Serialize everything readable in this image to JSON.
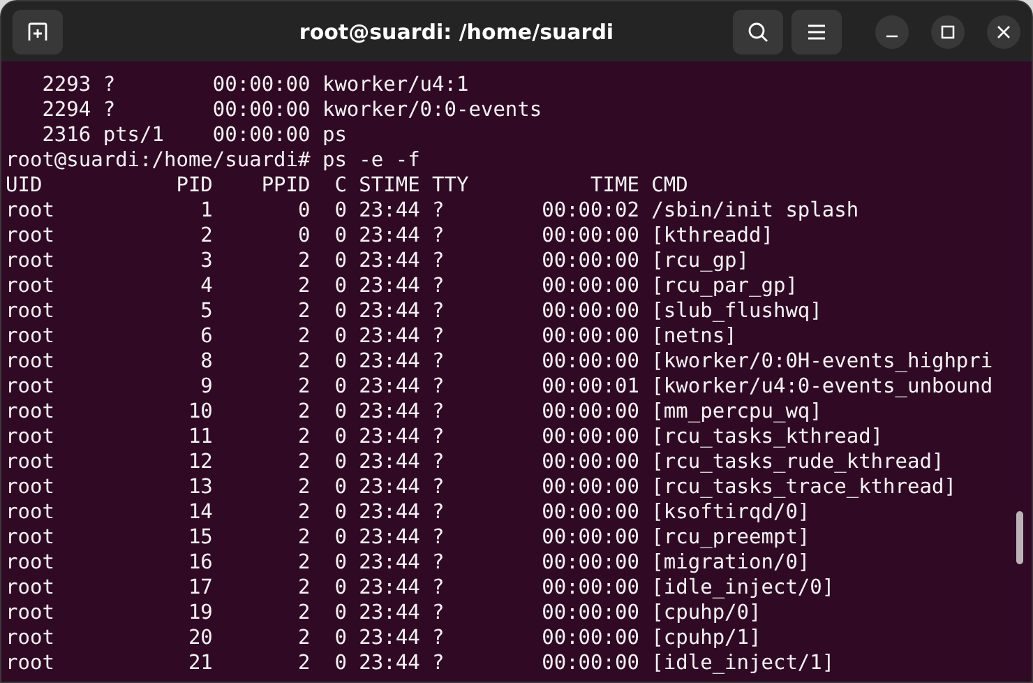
{
  "window": {
    "title": "root@suardi: /home/suardi"
  },
  "terminal": {
    "lines": [
      "   2293 ?        00:00:00 kworker/u4:1",
      "   2294 ?        00:00:00 kworker/0:0-events",
      "   2316 pts/1    00:00:00 ps",
      "root@suardi:/home/suardi# ps -e -f",
      "UID           PID    PPID  C STIME TTY          TIME CMD",
      "root            1       0  0 23:44 ?        00:00:02 /sbin/init splash",
      "root            2       0  0 23:44 ?        00:00:00 [kthreadd]",
      "root            3       2  0 23:44 ?        00:00:00 [rcu_gp]",
      "root            4       2  0 23:44 ?        00:00:00 [rcu_par_gp]",
      "root            5       2  0 23:44 ?        00:00:00 [slub_flushwq]",
      "root            6       2  0 23:44 ?        00:00:00 [netns]",
      "root            8       2  0 23:44 ?        00:00:00 [kworker/0:0H-events_highpri",
      "root            9       2  0 23:44 ?        00:00:01 [kworker/u4:0-events_unbound",
      "root           10       2  0 23:44 ?        00:00:00 [mm_percpu_wq]",
      "root           11       2  0 23:44 ?        00:00:00 [rcu_tasks_kthread]",
      "root           12       2  0 23:44 ?        00:00:00 [rcu_tasks_rude_kthread]",
      "root           13       2  0 23:44 ?        00:00:00 [rcu_tasks_trace_kthread]",
      "root           14       2  0 23:44 ?        00:00:00 [ksoftirqd/0]",
      "root           15       2  0 23:44 ?        00:00:00 [rcu_preempt]",
      "root           16       2  0 23:44 ?        00:00:00 [migration/0]",
      "root           17       2  0 23:44 ?        00:00:00 [idle_inject/0]",
      "root           19       2  0 23:44 ?        00:00:00 [cpuhp/0]",
      "root           20       2  0 23:44 ?        00:00:00 [cpuhp/1]",
      "root           21       2  0 23:44 ?        00:00:00 [idle_inject/1]"
    ]
  }
}
